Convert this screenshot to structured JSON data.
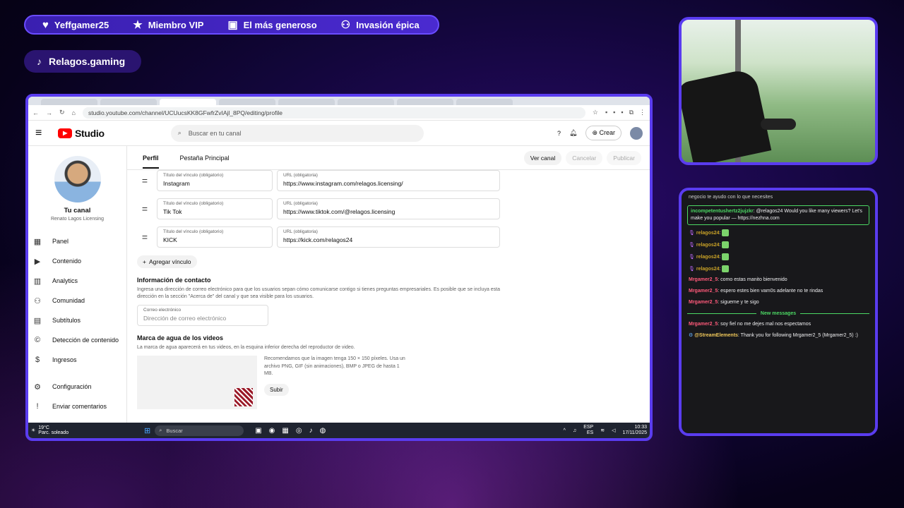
{
  "overlay": {
    "topbar": [
      {
        "icon": "heart-icon",
        "glyph": "♥",
        "label": "Yeffgamer25"
      },
      {
        "icon": "star-icon",
        "glyph": "★",
        "label": "Miembro VIP"
      },
      {
        "icon": "gift-icon",
        "glyph": "🎁",
        "label": "El más generoso"
      },
      {
        "icon": "users-icon",
        "glyph": "👥",
        "label": "Invasión épica"
      }
    ],
    "tiktok_handle": "Relagos.gaming"
  },
  "browser": {
    "url": "studio.youtube.com/channel/UCUucsKK8GFwfrZvIAjl_8PQ/editing/profile"
  },
  "studio": {
    "logo_text": "Studio",
    "search_placeholder": "Buscar en tu canal",
    "crear_label": "Crear",
    "sidebar": {
      "tu_canal": "Tu canal",
      "channel_name": "Renato Lagos Licensing",
      "items": [
        {
          "icon": "dashboard-icon",
          "glyph": "▦",
          "label": "Panel"
        },
        {
          "icon": "content-icon",
          "glyph": "▶",
          "label": "Contenido"
        },
        {
          "icon": "analytics-icon",
          "glyph": "▥",
          "label": "Analytics"
        },
        {
          "icon": "community-icon",
          "glyph": "👥",
          "label": "Comunidad"
        },
        {
          "icon": "subtitles-icon",
          "glyph": "▤",
          "label": "Subtítulos"
        },
        {
          "icon": "copyright-icon",
          "glyph": "©",
          "label": "Detección de contenido"
        },
        {
          "icon": "earn-icon",
          "glyph": "$",
          "label": "Ingresos"
        }
      ],
      "bottom_items": [
        {
          "icon": "gear-icon",
          "glyph": "⚙",
          "label": "Configuración"
        },
        {
          "icon": "feedback-icon",
          "glyph": "!",
          "label": "Enviar comentarios"
        }
      ]
    },
    "tabs": [
      "Perfil",
      "Pestaña Principal"
    ],
    "actions": {
      "ver_canal": "Ver canal",
      "cancelar": "Cancelar",
      "publicar": "Publicar"
    },
    "links": [
      {
        "title_label": "Título del vínculo (obligatorio)",
        "title": "Instagram",
        "url_label": "URL (obligatoria)",
        "url": "https://www.instagram.com/relagos.licensing/"
      },
      {
        "title_label": "Título del vínculo (obligatorio)",
        "title": "Tik Tok",
        "url_label": "URL (obligatoria)",
        "url": "https://www.tiktok.com/@relagos.licensing"
      },
      {
        "title_label": "Título del vínculo (obligatorio)",
        "title": "KICK",
        "url_label": "URL (obligatoria)",
        "url": "https://kick.com/relagos24"
      }
    ],
    "add_link": "Agregar vínculo",
    "contact": {
      "title": "Información de contacto",
      "desc": "Ingresa una dirección de correo electrónico para que los usuarios sepan cómo comunicarse contigo si tienes preguntas empresariales. Es posible que se incluya esta dirección en la sección \"Acerca de\" del canal y que sea visible para los usuarios.",
      "email_label": "Correo electrónico",
      "email_placeholder": "Dirección de correo electrónico"
    },
    "watermark": {
      "title": "Marca de agua de los videos",
      "desc": "La marca de agua aparecerá en tus videos, en la esquina inferior derecha del reproductor de video.",
      "reco": "Recomendamos que la imagen tenga 150 × 150 píxeles. Usa un archivo PNG, GIF (sin animaciones), BMP o JPEG de hasta 1 MB.",
      "upload": "Subir"
    }
  },
  "taskbar": {
    "temp": "19°C",
    "weather": "Parc. soleado",
    "search": "Buscar",
    "lang1": "ESP",
    "lang2": "ES",
    "time": "10:33",
    "date": "17/11/2025"
  },
  "chat": {
    "top_partial": "negocio te ayudo con lo que necesites",
    "highlight": {
      "user": "incompetentushertz2jujzkr",
      "text": ": @relagos24 Would you like many viewers? Let's make you popular — https://nezhna.com"
    },
    "messages": [
      {
        "user": "relagos24",
        "text": ":"
      },
      {
        "user": "relagos24",
        "text": ":"
      },
      {
        "user": "relagos24",
        "text": ":"
      },
      {
        "user": "relagos24",
        "text": ":"
      },
      {
        "user": "Mrgamer2_5",
        "text": ": como estas manito bienvenido"
      },
      {
        "user": "Mrgamer2_5",
        "text": ": espero estes bien vam0s adelante no te rindas"
      },
      {
        "user": "Mrgamer2_5",
        "text": ": sigueme y te sigo"
      }
    ],
    "new_messages": "New messages",
    "after": [
      {
        "user": "Mrgamer2_5",
        "text": ": soy fiel no me dejes mal nos espectamos"
      },
      {
        "user": "@StreamElements",
        "text": ": Thank you for following Mrgamer2_5 (Mrgamer2_5) :)"
      }
    ]
  },
  "colors": {
    "accent": "#5a3cf0",
    "yt_red": "#ff0000",
    "chat_green": "#4cd964",
    "relagos": "#c9a227",
    "mrgamer": "#ff5a7a"
  }
}
